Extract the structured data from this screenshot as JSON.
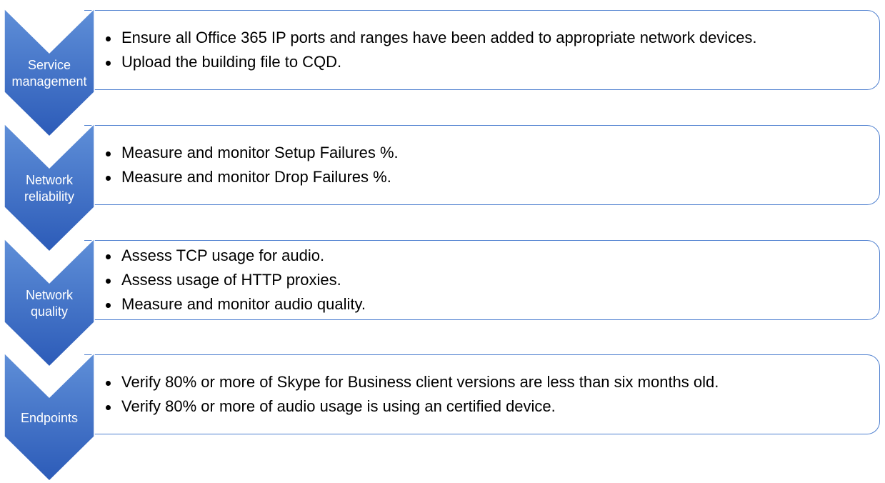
{
  "colors": {
    "chevron_top": "#5f8fd8",
    "chevron_bottom": "#2c5bb8",
    "panel_border": "#4f80d0",
    "label_text": "#ffffff",
    "bullet_text": "#000000"
  },
  "steps": [
    {
      "label": "Service\nmanagement",
      "items": [
        "Ensure all Office 365 IP ports and ranges have been added to appropriate network devices.",
        "Upload the building file to CQD."
      ]
    },
    {
      "label": "Network\nreliability",
      "items": [
        "Measure and monitor Setup Failures %.",
        "Measure and monitor Drop Failures %."
      ]
    },
    {
      "label": "Network\nquality",
      "items": [
        "Assess TCP usage for audio.",
        "Assess usage of HTTP proxies.",
        "Measure and monitor audio quality."
      ]
    },
    {
      "label": "Endpoints",
      "items": [
        "Verify 80% or more of Skype for Business client versions are less than six months old.",
        "Verify 80% or more of audio usage is using an certified device."
      ]
    }
  ]
}
